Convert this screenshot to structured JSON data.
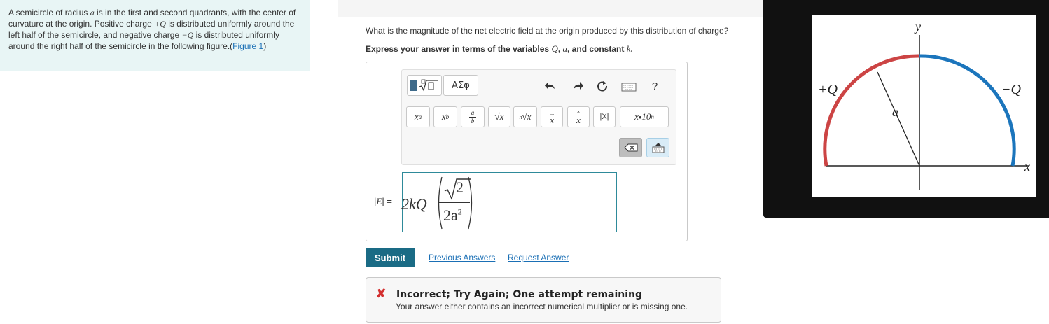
{
  "problem": {
    "text_1": "A semicircle of radius ",
    "a": "a",
    "text_2": " is in the first and second quadrants, with the center of curvature at the origin. Positive charge ",
    "plusQ": "+Q",
    "text_3": " is distributed uniformly around the left half of the semicircle, and negative charge ",
    "minusQ": "−Q",
    "text_4": " is distributed uniformly around the right half of the semicircle in the following figure.",
    "figure_link_open": "(",
    "figure_link": "Figure 1",
    "figure_link_close": ")"
  },
  "question": "What is the magnitude of the net electric field at the origin produced by this distribution of charge?",
  "instruction": {
    "prefix": "Express your answer in terms of the variables ",
    "q": "Q",
    "comma1": ", ",
    "a": "a",
    "comma2": ", and constant ",
    "k": "k",
    "period": "."
  },
  "toolbar": {
    "greek_label": "ΑΣφ",
    "help_label": "?",
    "buttons": {
      "superscript_base": "x",
      "superscript_exp": "a",
      "subscript_base": "x",
      "subscript_sub": "b",
      "frac_num": "a",
      "frac_den": "b",
      "sqrt": "√x",
      "nthroot_index": "n",
      "nthroot": "√x",
      "vector": "x",
      "unitvector": "x",
      "abs": "|X|",
      "sci_x": "x",
      "sci_dot": "•",
      "sci_ten": "10",
      "sci_n": "n"
    }
  },
  "answer": {
    "label_bar1": "|",
    "label_E": "E",
    "label_bar2": "|",
    "label_eq": " =",
    "coef": "2kQ",
    "num": "2",
    "den_base": "2a",
    "den_exp": "2"
  },
  "submit_label": "Submit",
  "previous_answers_label": "Previous Answers",
  "request_answer_label": "Request Answer",
  "feedback": {
    "icon": "✘",
    "title": "Incorrect; Try Again; One attempt remaining",
    "message": "Your answer either contains an incorrect numerical multiplier or is missing one."
  },
  "figure": {
    "y_label": "y",
    "x_label": "x",
    "plus_label": "+Q",
    "minus_label": "−Q",
    "radius_label": "a",
    "plus_color": "#cc4444",
    "minus_color": "#1b75bc"
  }
}
